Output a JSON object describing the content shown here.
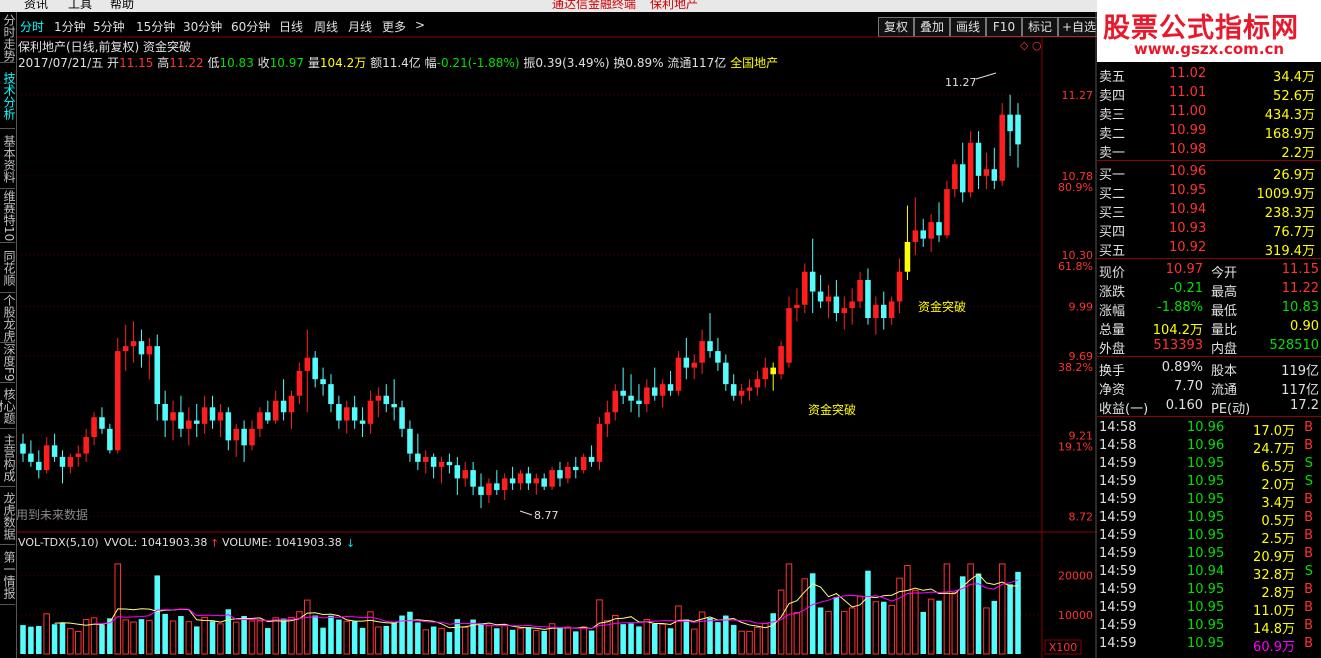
{
  "menu": {
    "items": [
      "资讯",
      "工具",
      "帮助"
    ],
    "title_left": "通达信金融终端",
    "title_right": "保利地产"
  },
  "left_tabs": [
    {
      "label": "分时走势",
      "active": false
    },
    {
      "label": "技术分析",
      "active": true
    },
    {
      "label": "基本资料",
      "active": false
    },
    {
      "label": "维赛特10",
      "active": false
    },
    {
      "label": "同花顺",
      "active": false
    },
    {
      "label": "个股龙虎",
      "active": false
    },
    {
      "label": "深度F9",
      "active": false
    },
    {
      "label": "核心题材",
      "active": false
    },
    {
      "label": "主营构成",
      "active": false
    },
    {
      "label": "龙虎数据",
      "active": false
    },
    {
      "label": "第一情报",
      "active": false
    }
  ],
  "toolbar": {
    "periods": [
      "分时",
      "1分钟",
      "5分钟",
      "15分钟",
      "30分钟",
      "60分钟",
      "日线",
      "周线",
      "月线",
      "更多"
    ],
    "more_arrow": ">",
    "buttons": [
      "复权",
      "叠加",
      "画线",
      "F10",
      "标记",
      "+自选"
    ]
  },
  "info": {
    "title": "保利地产(日线,前复权)",
    "indicator": "资金突破",
    "date": "2017/07/21/五",
    "open_label": "开",
    "open": "11.15",
    "high_label": "高",
    "high": "11.22",
    "low_label": "低",
    "low": "10.83",
    "close_label": "收",
    "close": "10.97",
    "vol_label": "量",
    "vol": "104.2万",
    "amt_label": "额",
    "amt": "11.4亿",
    "chg_label": "幅",
    "chg": "-0.21(-1.88%)",
    "amp_label": "振",
    "amp": "0.39(3.49%)",
    "turn_label": "换",
    "turn": "0.89%",
    "float_label": "流通",
    "float": "117亿",
    "sector": "全国地产"
  },
  "logo": {
    "line1": "股票公式指标网",
    "line2": "www.gszx.com.cn"
  },
  "chart_data": {
    "type": "candlestick",
    "price_axis": {
      "ylim": [
        8.65,
        11.42
      ],
      "ticks": [
        "11.27",
        "10.78",
        "10.30",
        "9.99",
        "9.69",
        "9.21",
        "8.72"
      ],
      "pct_ticks": [
        "80.9%",
        "61.8%",
        "38.2%",
        "19.1%"
      ]
    },
    "annotations": {
      "max_label": "11.27",
      "min_label": "8.77",
      "signal_label": "资金突破",
      "future_data": "用到未来数据"
    },
    "colors": {
      "up": "#ff1e1e",
      "down": "#54fcfc",
      "signal": "#ffff00",
      "ma_white": "#ffffff",
      "ma_yellow": "#ffff00",
      "ma_magenta": "#ff00ff"
    },
    "candles": [
      [
        9.16,
        9.22,
        9.05,
        9.1
      ],
      [
        9.1,
        9.18,
        9.02,
        9.05
      ],
      [
        9.05,
        9.12,
        8.95,
        9.0
      ],
      [
        9.0,
        9.2,
        8.98,
        9.15
      ],
      [
        9.15,
        9.22,
        9.05,
        9.08
      ],
      [
        9.08,
        9.12,
        8.92,
        9.02
      ],
      [
        9.02,
        9.1,
        8.98,
        9.08
      ],
      [
        9.08,
        9.15,
        9.02,
        9.1
      ],
      [
        9.1,
        9.25,
        9.05,
        9.2
      ],
      [
        9.2,
        9.35,
        9.15,
        9.32
      ],
      [
        9.32,
        9.38,
        9.22,
        9.25
      ],
      [
        9.25,
        9.28,
        9.1,
        9.12
      ],
      [
        9.12,
        9.8,
        9.1,
        9.72
      ],
      [
        9.72,
        9.88,
        9.6,
        9.75
      ],
      [
        9.75,
        9.9,
        9.65,
        9.78
      ],
      [
        9.78,
        9.85,
        9.62,
        9.7
      ],
      [
        9.7,
        9.8,
        9.55,
        9.75
      ],
      [
        9.75,
        9.82,
        9.3,
        9.4
      ],
      [
        9.4,
        9.48,
        9.2,
        9.3
      ],
      [
        9.3,
        9.42,
        9.18,
        9.35
      ],
      [
        9.35,
        9.45,
        9.2,
        9.25
      ],
      [
        9.25,
        9.38,
        9.15,
        9.3
      ],
      [
        9.3,
        9.4,
        9.2,
        9.28
      ],
      [
        9.28,
        9.45,
        9.22,
        9.38
      ],
      [
        9.38,
        9.45,
        9.25,
        9.3
      ],
      [
        9.3,
        9.4,
        9.2,
        9.35
      ],
      [
        9.35,
        9.38,
        9.12,
        9.18
      ],
      [
        9.18,
        9.28,
        9.08,
        9.25
      ],
      [
        9.25,
        9.3,
        9.05,
        9.15
      ],
      [
        9.15,
        9.3,
        9.12,
        9.25
      ],
      [
        9.25,
        9.38,
        9.2,
        9.35
      ],
      [
        9.35,
        9.42,
        9.28,
        9.3
      ],
      [
        9.3,
        9.48,
        9.28,
        9.42
      ],
      [
        9.42,
        9.55,
        9.3,
        9.35
      ],
      [
        9.35,
        9.48,
        9.25,
        9.45
      ],
      [
        9.45,
        9.65,
        9.4,
        9.6
      ],
      [
        9.6,
        9.85,
        9.35,
        9.68
      ],
      [
        9.68,
        9.72,
        9.5,
        9.55
      ],
      [
        9.55,
        9.62,
        9.45,
        9.52
      ],
      [
        9.52,
        9.58,
        9.35,
        9.4
      ],
      [
        9.4,
        9.45,
        9.25,
        9.3
      ],
      [
        9.3,
        9.42,
        9.22,
        9.38
      ],
      [
        9.38,
        9.45,
        9.25,
        9.3
      ],
      [
        9.3,
        9.38,
        9.2,
        9.28
      ],
      [
        9.28,
        9.48,
        9.22,
        9.42
      ],
      [
        9.42,
        9.5,
        9.32,
        9.45
      ],
      [
        9.45,
        9.52,
        9.35,
        9.4
      ],
      [
        9.4,
        9.55,
        9.3,
        9.38
      ],
      [
        9.38,
        9.42,
        9.2,
        9.25
      ],
      [
        9.25,
        9.3,
        9.05,
        9.1
      ],
      [
        9.1,
        9.22,
        9.0,
        9.05
      ],
      [
        9.05,
        9.12,
        8.98,
        9.08
      ],
      [
        9.08,
        9.1,
        8.95,
        9.02
      ],
      [
        9.02,
        9.08,
        8.92,
        9.05
      ],
      [
        9.05,
        9.1,
        8.98,
        9.03
      ],
      [
        9.03,
        9.08,
        8.85,
        8.95
      ],
      [
        8.95,
        9.05,
        8.9,
        9.0
      ],
      [
        9.0,
        9.05,
        8.85,
        8.9
      ],
      [
        8.9,
        8.98,
        8.77,
        8.85
      ],
      [
        8.85,
        8.95,
        8.8,
        8.92
      ],
      [
        8.92,
        9.0,
        8.85,
        8.88
      ],
      [
        8.88,
        8.98,
        8.82,
        8.95
      ],
      [
        8.95,
        9.02,
        8.88,
        8.92
      ],
      [
        8.92,
        9.0,
        8.88,
        8.98
      ],
      [
        8.98,
        9.02,
        8.88,
        8.92
      ],
      [
        8.92,
        8.98,
        8.85,
        8.95
      ],
      [
        8.95,
        8.98,
        8.88,
        8.9
      ],
      [
        8.9,
        9.02,
        8.88,
        9.0
      ],
      [
        9.0,
        9.05,
        8.9,
        8.95
      ],
      [
        8.95,
        9.05,
        8.92,
        9.02
      ],
      [
        9.02,
        9.08,
        8.95,
        9.0
      ],
      [
        9.0,
        9.1,
        8.98,
        9.08
      ],
      [
        9.08,
        9.15,
        9.02,
        9.05
      ],
      [
        9.05,
        9.32,
        9.0,
        9.28
      ],
      [
        9.28,
        9.42,
        9.2,
        9.35
      ],
      [
        9.35,
        9.52,
        9.3,
        9.48
      ],
      [
        9.48,
        9.62,
        9.4,
        9.45
      ],
      [
        9.45,
        9.58,
        9.35,
        9.42
      ],
      [
        9.42,
        9.52,
        9.32,
        9.4
      ],
      [
        9.4,
        9.55,
        9.35,
        9.5
      ],
      [
        9.5,
        9.62,
        9.42,
        9.45
      ],
      [
        9.45,
        9.55,
        9.38,
        9.52
      ],
      [
        9.52,
        9.6,
        9.45,
        9.48
      ],
      [
        9.48,
        9.72,
        9.45,
        9.68
      ],
      [
        9.68,
        9.8,
        9.55,
        9.62
      ],
      [
        9.62,
        9.7,
        9.55,
        9.65
      ],
      [
        9.65,
        9.85,
        9.58,
        9.78
      ],
      [
        9.78,
        9.95,
        9.68,
        9.72
      ],
      [
        9.72,
        9.8,
        9.6,
        9.65
      ],
      [
        9.65,
        9.7,
        9.48,
        9.52
      ],
      [
        9.52,
        9.58,
        9.42,
        9.45
      ],
      [
        9.45,
        9.52,
        9.4,
        9.48
      ],
      [
        9.48,
        9.55,
        9.42,
        9.5
      ],
      [
        9.5,
        9.6,
        9.45,
        9.55
      ],
      [
        9.55,
        9.68,
        9.5,
        9.62
      ],
      [
        9.62,
        9.65,
        9.48,
        9.58
      ],
      [
        9.58,
        9.78,
        9.55,
        9.75
      ],
      [
        9.65,
        10.05,
        9.62,
        9.98
      ],
      [
        9.98,
        10.1,
        9.9,
        10.0
      ],
      [
        10.0,
        10.25,
        9.95,
        10.2
      ],
      [
        10.2,
        10.4,
        9.95,
        10.08
      ],
      [
        10.08,
        10.18,
        9.98,
        10.02
      ],
      [
        10.02,
        10.12,
        9.92,
        10.05
      ],
      [
        10.05,
        10.15,
        9.9,
        9.95
      ],
      [
        9.95,
        10.05,
        9.85,
        9.98
      ],
      [
        9.98,
        10.1,
        9.88,
        10.02
      ],
      [
        10.02,
        10.2,
        9.98,
        10.15
      ],
      [
        10.15,
        10.22,
        9.88,
        9.92
      ],
      [
        9.92,
        10.05,
        9.82,
        10.0
      ],
      [
        10.0,
        10.08,
        9.85,
        9.92
      ],
      [
        9.92,
        10.05,
        9.88,
        10.02
      ],
      [
        10.02,
        10.28,
        9.95,
        10.2
      ],
      [
        10.2,
        10.6,
        10.15,
        10.38
      ],
      [
        10.38,
        10.65,
        10.3,
        10.45
      ],
      [
        10.45,
        10.52,
        10.35,
        10.4
      ],
      [
        10.4,
        10.55,
        10.32,
        10.5
      ],
      [
        10.5,
        10.62,
        10.38,
        10.42
      ],
      [
        10.42,
        10.75,
        10.4,
        10.7
      ],
      [
        10.7,
        10.88,
        10.65,
        10.85
      ],
      [
        10.85,
        10.98,
        10.62,
        10.68
      ],
      [
        10.68,
        11.05,
        10.65,
        10.98
      ],
      [
        10.98,
        11.05,
        10.7,
        10.78
      ],
      [
        10.78,
        10.92,
        10.7,
        10.82
      ],
      [
        10.82,
        10.95,
        10.7,
        10.75
      ],
      [
        10.75,
        11.22,
        10.72,
        11.15
      ],
      [
        11.15,
        11.27,
        10.9,
        11.05
      ],
      [
        11.15,
        11.22,
        10.83,
        10.97
      ]
    ],
    "volume": {
      "label": "VOL-TDX(5,10)",
      "vvol_label": "VVOL: 1041903.38",
      "volume_label": "VOLUME: 1041903.38",
      "ticks": [
        "20000",
        "10000"
      ],
      "unit": "X100"
    }
  },
  "quote": {
    "sell": [
      [
        "卖五",
        "11.02",
        "34.4万"
      ],
      [
        "卖四",
        "11.01",
        "52.6万"
      ],
      [
        "卖三",
        "11.00",
        "434.3万"
      ],
      [
        "卖二",
        "10.99",
        "168.9万"
      ],
      [
        "卖一",
        "10.98",
        "2.2万"
      ]
    ],
    "buy": [
      [
        "买一",
        "10.96",
        "26.9万"
      ],
      [
        "买二",
        "10.95",
        "1009.9万"
      ],
      [
        "买三",
        "10.94",
        "238.3万"
      ],
      [
        "买四",
        "10.93",
        "76.7万"
      ],
      [
        "买五",
        "10.92",
        "319.4万"
      ]
    ],
    "stats": [
      [
        "现价",
        "10.97",
        "今开",
        "11.15"
      ],
      [
        "涨跌",
        "-0.21",
        "最高",
        "11.22"
      ],
      [
        "涨幅",
        "-1.88%",
        "最低",
        "10.83"
      ],
      [
        "总量",
        "104.2万",
        "量比",
        "0.90"
      ],
      [
        "外盘",
        "513393",
        "内盘",
        "528510"
      ],
      [
        "换手",
        "0.89%",
        "股本",
        "119亿"
      ],
      [
        "净资",
        "7.70",
        "流通",
        "117亿"
      ],
      [
        "收益(一)",
        "0.160",
        "PE(动)",
        "17.2"
      ]
    ],
    "ticks": [
      [
        "14:58",
        "10.96",
        "17.0万",
        "B"
      ],
      [
        "14:58",
        "10.96",
        "24.7万",
        "B"
      ],
      [
        "14:59",
        "10.95",
        "6.5万",
        "S"
      ],
      [
        "14:59",
        "10.95",
        "2.0万",
        "S"
      ],
      [
        "14:59",
        "10.95",
        "3.4万",
        "B"
      ],
      [
        "14:59",
        "10.95",
        "0.5万",
        "B"
      ],
      [
        "14:59",
        "10.95",
        "2.5万",
        "B"
      ],
      [
        "14:59",
        "10.95",
        "20.9万",
        "B"
      ],
      [
        "14:59",
        "10.94",
        "32.8万",
        "S"
      ],
      [
        "14:59",
        "10.95",
        "2.8万",
        "B"
      ],
      [
        "14:59",
        "10.95",
        "11.0万",
        "B"
      ],
      [
        "14:59",
        "10.95",
        "14.8万",
        "B"
      ],
      [
        "14:59",
        "10.95",
        "60.9万",
        "B"
      ]
    ]
  }
}
